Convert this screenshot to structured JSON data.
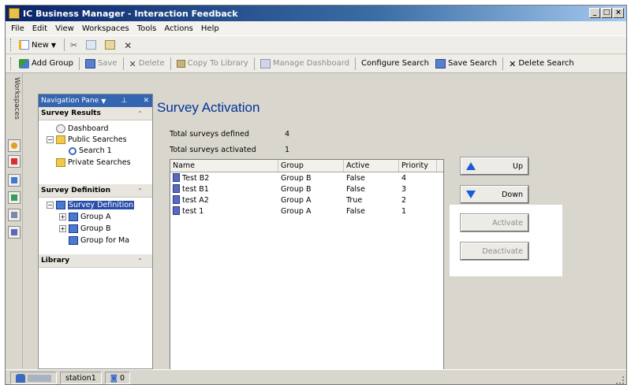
{
  "window": {
    "title": "IC Business Manager - Interaction Feedback"
  },
  "menu": [
    "File",
    "Edit",
    "View",
    "Workspaces",
    "Tools",
    "Actions",
    "Help"
  ],
  "toolbar1": {
    "new_label": "New"
  },
  "toolbar2": {
    "add_group": "Add Group",
    "save": "Save",
    "delete": "Delete",
    "copy_to_library": "Copy To Library",
    "manage_dashboard": "Manage Dashboard",
    "configure_search": "Configure Search",
    "save_search": "Save Search",
    "delete_search": "Delete Search"
  },
  "workspaces_tab": "Workspaces",
  "nav": {
    "title": "Navigation Pane",
    "sections": {
      "survey_results": "Survey Results",
      "survey_definition": "Survey Definition",
      "library": "Library"
    },
    "tree": {
      "dashboard": "Dashboard",
      "public_searches": "Public Searches",
      "search1": "Search 1",
      "private_searches": "Private Searches",
      "survey_definition": "Survey Definition",
      "group_a": "Group A",
      "group_b": "Group B",
      "group_for_ma": "Group for Ma"
    }
  },
  "main": {
    "title": "Survey Activation",
    "total_defined_label": "Total surveys defined",
    "total_defined_value": "4",
    "total_activated_label": "Total surveys activated",
    "total_activated_value": "1",
    "columns": [
      "Name",
      "Group",
      "Active",
      "Priority"
    ],
    "rows": [
      {
        "name": "Test B2",
        "group": "Group B",
        "active": "False",
        "priority": "4"
      },
      {
        "name": "test B1",
        "group": "Group B",
        "active": "False",
        "priority": "3"
      },
      {
        "name": "test A2",
        "group": "Group A",
        "active": "True",
        "priority": "2"
      },
      {
        "name": "test 1",
        "group": "Group A",
        "active": "False",
        "priority": "1"
      }
    ],
    "buttons": {
      "up": "Up",
      "down": "Down",
      "activate": "Activate",
      "deactivate": "Deactivate"
    }
  },
  "status": {
    "station": "station1",
    "count": "0"
  },
  "colors": {
    "accent": "#003399",
    "title_bar": "#0a246a",
    "arrow": "#1a5ad8"
  }
}
